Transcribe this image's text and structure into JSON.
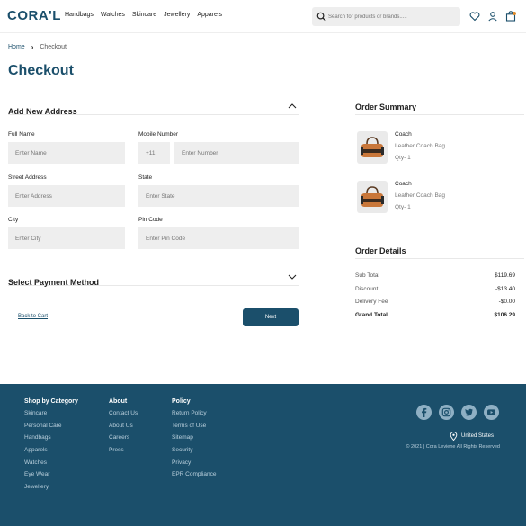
{
  "header": {
    "logo": "CORA'L",
    "nav": [
      "Handbags",
      "Watches",
      "Skincare",
      "Jewellery",
      "Apparels"
    ],
    "search_placeholder": "Search for products or brands....."
  },
  "breadcrumb": {
    "home": "Home",
    "separator": "›",
    "current": "Checkout"
  },
  "page_title": "Checkout",
  "address": {
    "title": "Add New Address",
    "full_name_label": "Full Name",
    "full_name_placeholder": "Enter Name",
    "mobile_label": "Mobile Number",
    "country_code": "+11",
    "mobile_placeholder": "Enter Number",
    "street_label": "Street Address",
    "street_placeholder": "Enter Address",
    "state_label": "State",
    "state_placeholder": "Enter State",
    "city_label": "City",
    "city_placeholder": "Enter City",
    "pin_label": "Pin Code",
    "pin_placeholder": "Enter Pin Code"
  },
  "payment": {
    "title": "Select Payment Method"
  },
  "actions": {
    "back_label": "Back to Cart",
    "next_label": "Next"
  },
  "summary": {
    "title": "Order Summary",
    "items": [
      {
        "brand": "Coach",
        "name": "Leather Coach Bag",
        "qty": "Qty- 1"
      },
      {
        "brand": "Coach",
        "name": "Leather Coach Bag",
        "qty": "Qty- 1"
      }
    ]
  },
  "details": {
    "title": "Order Details",
    "rows": [
      {
        "label": "Sub Total",
        "value": "$119.69"
      },
      {
        "label": "Discount",
        "value": "-$13.40"
      },
      {
        "label": "Delivery Fee",
        "value": "-$0.00"
      },
      {
        "label": "Grand Total",
        "value": "$106.29"
      }
    ]
  },
  "footer": {
    "category": {
      "title": "Shop by Category",
      "links": [
        "Skincare",
        "Personal Care",
        "Handbags",
        "Apparels",
        "Watches",
        "Eye Wear",
        "Jewellery"
      ]
    },
    "about": {
      "title": "About",
      "links": [
        "Contact Us",
        "About Us",
        "Careers",
        "Press"
      ]
    },
    "policy": {
      "title": "Policy",
      "links": [
        "Return Policy",
        "Terms of Use",
        "Sitemap",
        "Security",
        "Privacy",
        "EPR Compliance"
      ]
    },
    "social_icons": [
      "facebook-icon",
      "instagram-icon",
      "twitter-icon",
      "youtube-icon"
    ],
    "country": "United States",
    "copyright": "© 2021 | Cora Leviene All Rights Reserved"
  },
  "colors": {
    "primary": "#1b4f6b",
    "input_bg": "#eeeeee",
    "footer_link": "#b9cfdc"
  }
}
